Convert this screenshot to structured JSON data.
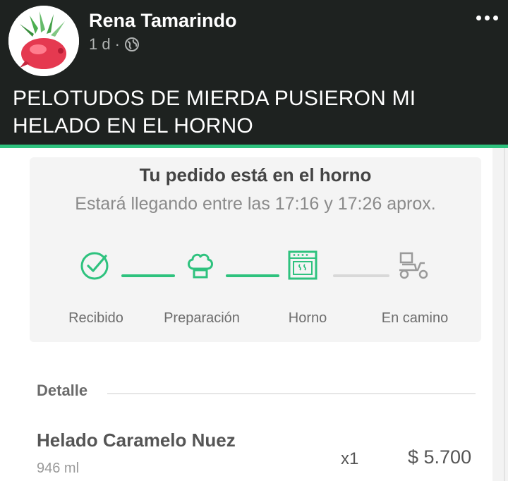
{
  "post": {
    "author": "Rena Tamarindo",
    "time": "1 d",
    "separator": "·",
    "privacy_icon": "globe-icon",
    "menu_icon": "more-options-icon",
    "text": "PELOTUDOS DE MIERDA PUSIERON MI HELADO EN EL HORNO"
  },
  "order_status": {
    "title": "Tu pedido está en el horno",
    "subtitle": "Estará llegando entre las 17:16 y 17:26 aprox.",
    "steps": [
      {
        "label": "Recibido",
        "icon": "check-circle-icon",
        "state": "done"
      },
      {
        "label": "Preparación",
        "icon": "chef-hat-icon",
        "state": "done"
      },
      {
        "label": "Horno",
        "icon": "oven-icon",
        "state": "current"
      },
      {
        "label": "En camino",
        "icon": "delivery-scooter-icon",
        "state": "pending"
      }
    ],
    "colors": {
      "active": "#2ec27e",
      "pending": "#d8d8d8"
    }
  },
  "detail": {
    "label": "Detalle",
    "item": {
      "name": "Helado Caramelo Nuez",
      "size": "946 ml",
      "qty": "x1",
      "price": "$ 5.700"
    }
  }
}
